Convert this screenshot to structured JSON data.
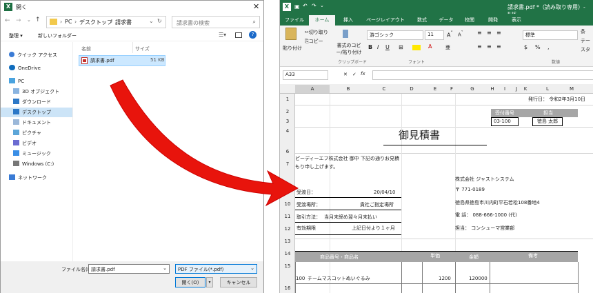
{
  "dialog": {
    "title": "開く",
    "path": [
      "PC",
      "デスクトップ",
      "請求書"
    ],
    "search_placeholder": "請求書の検索",
    "organize": "整理 ▾",
    "new_folder": "新しいフォルダー",
    "nav": [
      "クイック アクセス",
      "OneDrive",
      "PC",
      "3D オブジェクト",
      "ダウンロード",
      "デスクトップ",
      "ドキュメント",
      "ピクチャ",
      "ビデオ",
      "ミュージック",
      "Windows (C:)",
      "ネットワーク"
    ],
    "col_name": "名前",
    "col_size": "サイズ",
    "file": {
      "name": "請求書.pdf",
      "size": "51 KB"
    },
    "filename_label": "ファイル名(N):",
    "filename_value": "請求書.pdf",
    "filetype": "PDF ファイル(*.pdf)",
    "open": "開く(O)",
    "cancel": "キャンセル"
  },
  "excel": {
    "title": "請求書.pdf *（読み取り専用）- JUS",
    "tabs": [
      "ファイル",
      "ホーム",
      "挿入",
      "ページレイアウト",
      "数式",
      "データ",
      "校閲",
      "開発",
      "表示"
    ],
    "clipboard": {
      "paste": "貼り付け",
      "cut": "切り取り",
      "copy": "コピー",
      "format": "書式のコピー/貼り付け",
      "group": "クリップボード"
    },
    "font": {
      "name": "游ゴシック",
      "size": "11",
      "group": "フォント"
    },
    "number": {
      "format": "標準",
      "group": "数値"
    },
    "cond": "条",
    "table": "テー",
    "style": "スタ",
    "namebox": "A33",
    "fx": "fx",
    "cols": [
      "A",
      "B",
      "C",
      "D",
      "E",
      "F",
      "G",
      "H",
      "I",
      "J",
      "K",
      "L",
      "M"
    ],
    "rows": [
      "1",
      "2",
      "3",
      "4",
      "6",
      "7",
      "",
      "10",
      "11",
      "12",
      "13",
      "14",
      "15",
      "16"
    ],
    "issue_date": "発行日： 令和2年3月10日",
    "receipt_no_label": "受付番号",
    "receipt_no": "03-100",
    "person_label": "担当",
    "person": "徳島 太郎",
    "doc_title": "御見積書",
    "intro": "ピーディーエフ株式会社 御中 下記の通りお見積もり申し上げます。",
    "company": "株式会社 ジャストシステム",
    "delivery_date_label": "受渡日：",
    "delivery_date": "20/04/10",
    "postal": "〒 771-0189",
    "place_label": "受渡場所：",
    "place": "貴社ご指定場所",
    "address": "徳島県徳島市川内町平石若松108番地4",
    "terms_label": "取引方法：",
    "terms": "当月末締め翌々月末払い",
    "tel": "電 話： 088-666-1000 (代)",
    "expiry_label": "有効期限",
    "expiry": "上記日付より１ヶ月",
    "charge": "担当： コンシューマ営業部",
    "th_item": "商品番号・商品名",
    "th_price": "単価",
    "th_amount": "金額",
    "th_note": "備考",
    "item_no": "100",
    "item_name": "チームマスコットぬいぐるみ",
    "item_price": "1200",
    "item_amount": "120000"
  },
  "colors": {
    "arrow": "#e8140c",
    "excel_green": "#217346"
  }
}
